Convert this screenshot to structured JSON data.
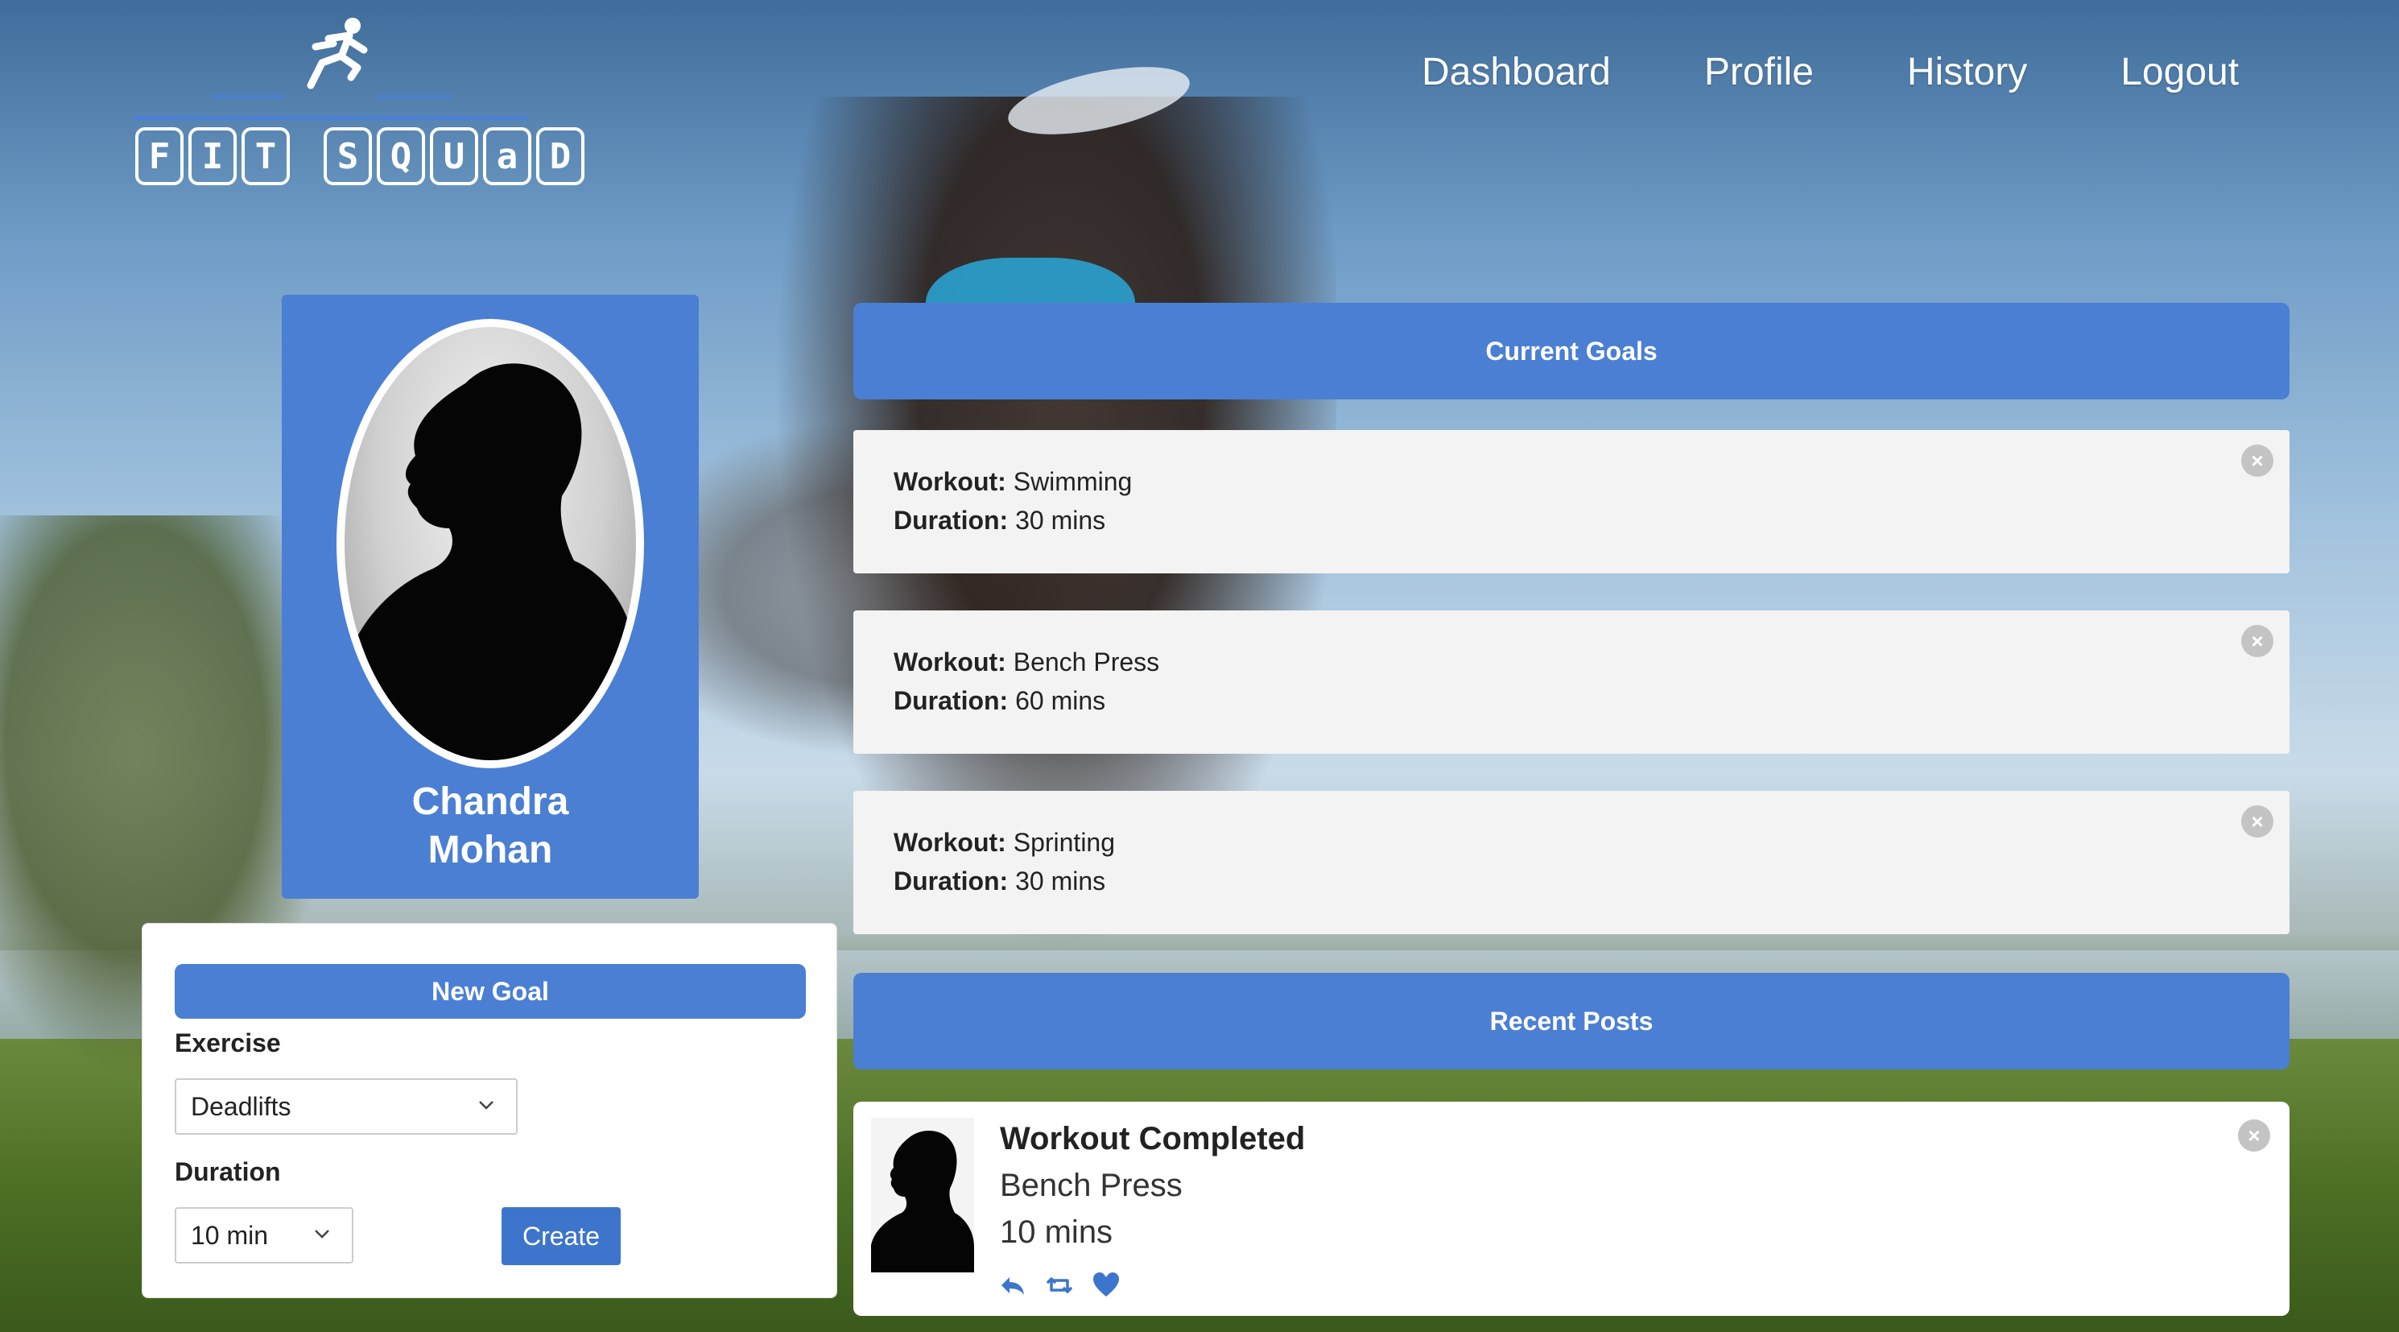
{
  "brand": {
    "logo_letters": [
      "F",
      "I",
      "T",
      "S",
      "Q",
      "U",
      "a",
      "D"
    ],
    "logo_text": "FIT SQUAD"
  },
  "nav": {
    "items": [
      "Dashboard",
      "Profile",
      "History",
      "Logout"
    ]
  },
  "profile": {
    "name_first": "Chandra",
    "name_last": "Mohan"
  },
  "goal_form": {
    "title": "New Goal",
    "exercise_label": "Exercise",
    "exercise_value": "Deadlifts",
    "duration_label": "Duration",
    "duration_value": "10 min",
    "create_label": "Create"
  },
  "current_goals": {
    "header": "Current Goals",
    "workout_label": "Workout:",
    "duration_label": "Duration:",
    "items": [
      {
        "workout": "Swimming",
        "duration": "30 mins"
      },
      {
        "workout": "Bench Press",
        "duration": "60 mins"
      },
      {
        "workout": "Sprinting",
        "duration": "30 mins"
      }
    ]
  },
  "recent_posts": {
    "header": "Recent Posts",
    "items": [
      {
        "title": "Workout Completed",
        "exercise": "Bench Press",
        "duration": "10 mins"
      }
    ]
  },
  "colors": {
    "accent": "#4a7fd4",
    "card_bg": "#f3f3f3",
    "close_icon": "#c4c4c4"
  },
  "icons": [
    "runner-logo-icon",
    "close-icon",
    "chevron-down-icon",
    "reply-icon",
    "retweet-icon",
    "heart-icon"
  ]
}
